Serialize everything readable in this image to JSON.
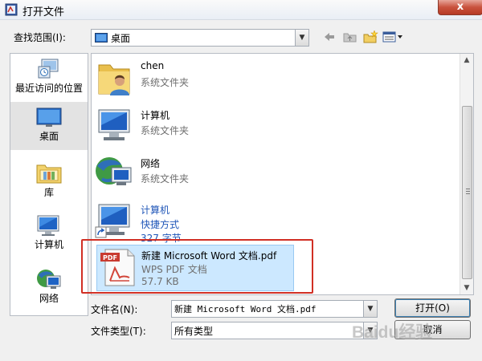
{
  "window": {
    "title": "打开文件",
    "close_glyph": "x"
  },
  "toolbar": {
    "lookin_label": "查找范围(I):",
    "lookin_value": "桌面",
    "icons": [
      "back-arrow-icon",
      "up-folder-icon",
      "new-folder-icon",
      "view-menu-icon"
    ]
  },
  "places": [
    {
      "label": "最近访问的位置",
      "icon": "recent-places-icon"
    },
    {
      "label": "桌面",
      "icon": "desktop-icon",
      "selected": true
    },
    {
      "label": "库",
      "icon": "libraries-icon"
    },
    {
      "label": "计算机",
      "icon": "computer-icon"
    },
    {
      "label": "网络",
      "icon": "network-icon"
    }
  ],
  "files": [
    {
      "name": "chen",
      "sub1": "系统文件夹",
      "icon": "user-folder-icon"
    },
    {
      "name": "计算机",
      "sub1": "系统文件夹",
      "icon": "computer-icon"
    },
    {
      "name": "网络",
      "sub1": "系统文件夹",
      "icon": "network-icon"
    },
    {
      "name": "计算机",
      "sub1": "快捷方式",
      "sub2": "327 字节",
      "icon": "computer-shortcut-icon"
    },
    {
      "name": "新建 Microsoft Word 文档.pdf",
      "sub1": "WPS PDF 文档",
      "sub2": "57.7 KB",
      "icon": "pdf-icon",
      "selected": true
    }
  ],
  "pdf_badge": "PDF",
  "form": {
    "filename_label": "文件名(N):",
    "filename_value": "新建 Microsoft Word 文档.pdf",
    "filetype_label": "文件类型(T):",
    "filetype_value": "所有类型",
    "open_button": "打开(O)",
    "cancel_button": "取消"
  },
  "watermark": "Baidu经验",
  "colors": {
    "highlight_border": "#d12f24",
    "link_blue": "#1f56b8",
    "selection": "#cce8ff"
  }
}
